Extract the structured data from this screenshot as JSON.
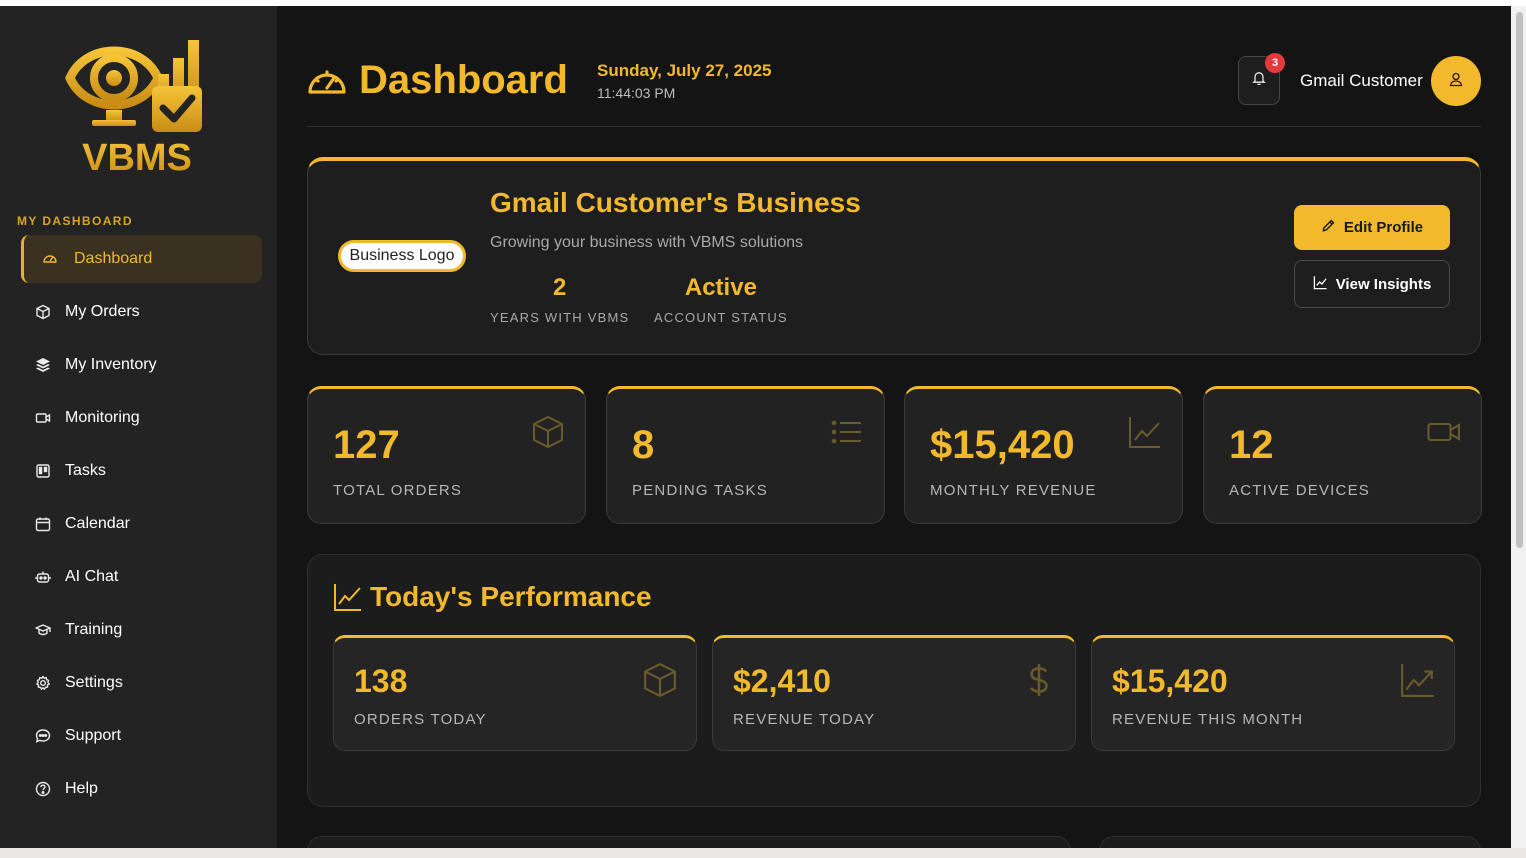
{
  "brand": {
    "logo_text": "VBMS",
    "accent": "#f1b92b"
  },
  "sidebar": {
    "section_label": "MY DASHBOARD",
    "items": [
      {
        "label": "Dashboard",
        "icon": "gauge-icon",
        "active": true
      },
      {
        "label": "My Orders",
        "icon": "box-icon"
      },
      {
        "label": "My Inventory",
        "icon": "layers-icon"
      },
      {
        "label": "Monitoring",
        "icon": "camera-icon"
      },
      {
        "label": "Tasks",
        "icon": "kanban-icon"
      },
      {
        "label": "Calendar",
        "icon": "calendar-icon"
      },
      {
        "label": "AI Chat",
        "icon": "robot-icon"
      },
      {
        "label": "Training",
        "icon": "graduation-cap-icon"
      },
      {
        "label": "Settings",
        "icon": "gear-icon"
      },
      {
        "label": "Support",
        "icon": "chat-bubble-icon"
      },
      {
        "label": "Help",
        "icon": "question-circle-icon"
      }
    ]
  },
  "header": {
    "title": "Dashboard",
    "date": "Sunday, July 27, 2025",
    "time": "11:44:03 PM",
    "notification_count": "3",
    "user_name": "Gmail Customer"
  },
  "business": {
    "logo_alt": "Business Logo",
    "name": "Gmail Customer's Business",
    "tagline": "Growing your business with VBMS solutions",
    "stats": [
      {
        "value": "2",
        "label": "YEARS WITH VBMS"
      },
      {
        "value": "Active",
        "label": "ACCOUNT STATUS"
      }
    ],
    "edit_label": "Edit Profile",
    "insights_label": "View Insights"
  },
  "stats": [
    {
      "value": "127",
      "label": "TOTAL ORDERS",
      "icon": "box-icon"
    },
    {
      "value": "8",
      "label": "PENDING TASKS",
      "icon": "list-icon"
    },
    {
      "value": "$15,420",
      "label": "MONTHLY REVENUE",
      "icon": "line-chart-icon"
    },
    {
      "value": "12",
      "label": "ACTIVE DEVICES",
      "icon": "video-camera-icon"
    }
  ],
  "performance": {
    "title": "Today's Performance",
    "cards": [
      {
        "value": "138",
        "label": "ORDERS TODAY",
        "icon": "box-icon"
      },
      {
        "value": "$2,410",
        "label": "REVENUE TODAY",
        "icon": "dollar-icon"
      },
      {
        "value": "$15,420",
        "label": "REVENUE THIS MONTH",
        "icon": "trend-up-icon"
      }
    ]
  }
}
